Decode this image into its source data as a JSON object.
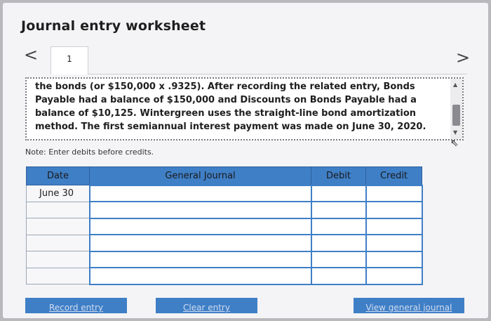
{
  "title": "Journal entry worksheet",
  "nav": {
    "prev": "<",
    "next": ">"
  },
  "tabs": [
    {
      "label": "1"
    }
  ],
  "question": "the bonds (or $150,000 x .9325). After recording the related entry, Bonds\nPayable had a balance of $150,000 and Discounts on Bonds Payable had a\nbalance of $10,125. Wintergreen uses the straight-line bond amortization\nmethod. The first semiannual interest payment was made on June 30, 2020.",
  "note": "Note: Enter debits before credits.",
  "table": {
    "headers": [
      "Date",
      "General Journal",
      "Debit",
      "Credit"
    ],
    "rows": [
      {
        "date": "June 30"
      },
      {
        "date": ""
      },
      {
        "date": ""
      },
      {
        "date": ""
      },
      {
        "date": ""
      },
      {
        "date": ""
      }
    ]
  },
  "buttons": {
    "record": "Record entry",
    "clear": "Clear entry",
    "view": "View general journal"
  },
  "colors": {
    "accent": "#3f7fc6",
    "background": "#f4f4f6"
  }
}
